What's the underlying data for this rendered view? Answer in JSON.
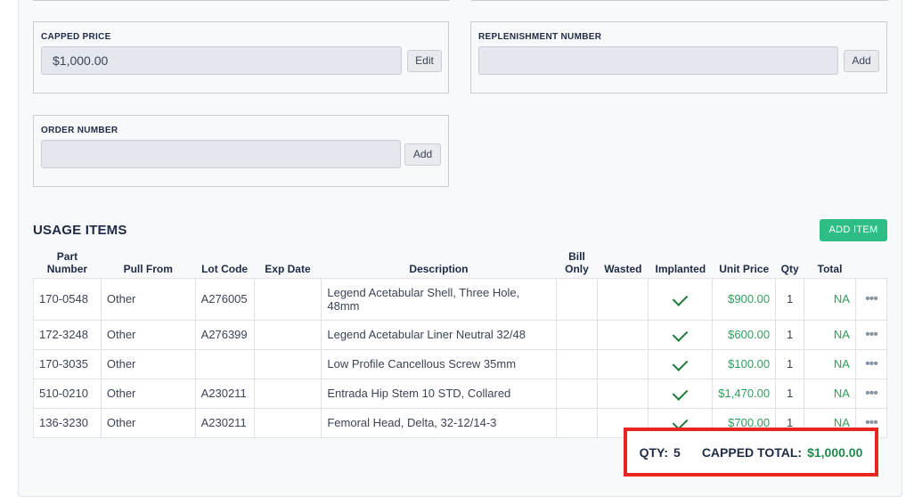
{
  "fields": {
    "capped_price": {
      "label": "CAPPED PRICE",
      "value": "$1,000.00",
      "button": "Edit"
    },
    "replenishment_number": {
      "label": "REPLENISHMENT NUMBER",
      "value": "",
      "button": "Add"
    },
    "order_number": {
      "label": "ORDER NUMBER",
      "value": "",
      "button": "Add"
    }
  },
  "usage": {
    "title": "USAGE ITEMS",
    "add_button": "ADD ITEM",
    "columns": [
      "Part Number",
      "Pull From",
      "Lot Code",
      "Exp Date",
      "Description",
      "Bill Only",
      "Wasted",
      "Implanted",
      "Unit Price",
      "Qty",
      "Total"
    ],
    "rows": [
      {
        "part": "170-0548",
        "pull": "Other",
        "lot": "A276005",
        "exp": "",
        "desc": "Legend Acetabular Shell, Three Hole, 48mm",
        "bill": "",
        "wasted": "",
        "implanted": "check-icon",
        "price": "$900.00",
        "qty": "1",
        "total": "NA"
      },
      {
        "part": "172-3248",
        "pull": "Other",
        "lot": "A276399",
        "exp": "",
        "desc": "Legend Acetabular Liner Neutral 32/48",
        "bill": "",
        "wasted": "",
        "implanted": "check-icon",
        "price": "$600.00",
        "qty": "1",
        "total": "NA"
      },
      {
        "part": "170-3035",
        "pull": "Other",
        "lot": "",
        "exp": "",
        "desc": "Low Profile Cancellous Screw 35mm",
        "bill": "",
        "wasted": "",
        "implanted": "check-icon",
        "price": "$100.00",
        "qty": "1",
        "total": "NA"
      },
      {
        "part": "510-0210",
        "pull": "Other",
        "lot": "A230211",
        "exp": "",
        "desc": "Entrada Hip Stem 10 STD, Collared",
        "bill": "",
        "wasted": "",
        "implanted": "check-icon",
        "price": "$1,470.00",
        "qty": "1",
        "total": "NA"
      },
      {
        "part": "136-3230",
        "pull": "Other",
        "lot": "A230211",
        "exp": "",
        "desc": "Femoral Head, Delta, 32-12/14-3",
        "bill": "",
        "wasted": "",
        "implanted": "check-icon",
        "price": "$700.00",
        "qty": "1",
        "total": "NA"
      }
    ],
    "row_menu_icon": "more-dots-icon"
  },
  "summary": {
    "qty_label": "QTY:",
    "qty_value": "5",
    "capped_total_label": "CAPPED TOTAL:",
    "capped_total_value": "$1,000.00"
  },
  "colors": {
    "accent_button": "#2ebd85",
    "price_green": "#2f9e5c",
    "highlight_border": "#e8251f"
  }
}
